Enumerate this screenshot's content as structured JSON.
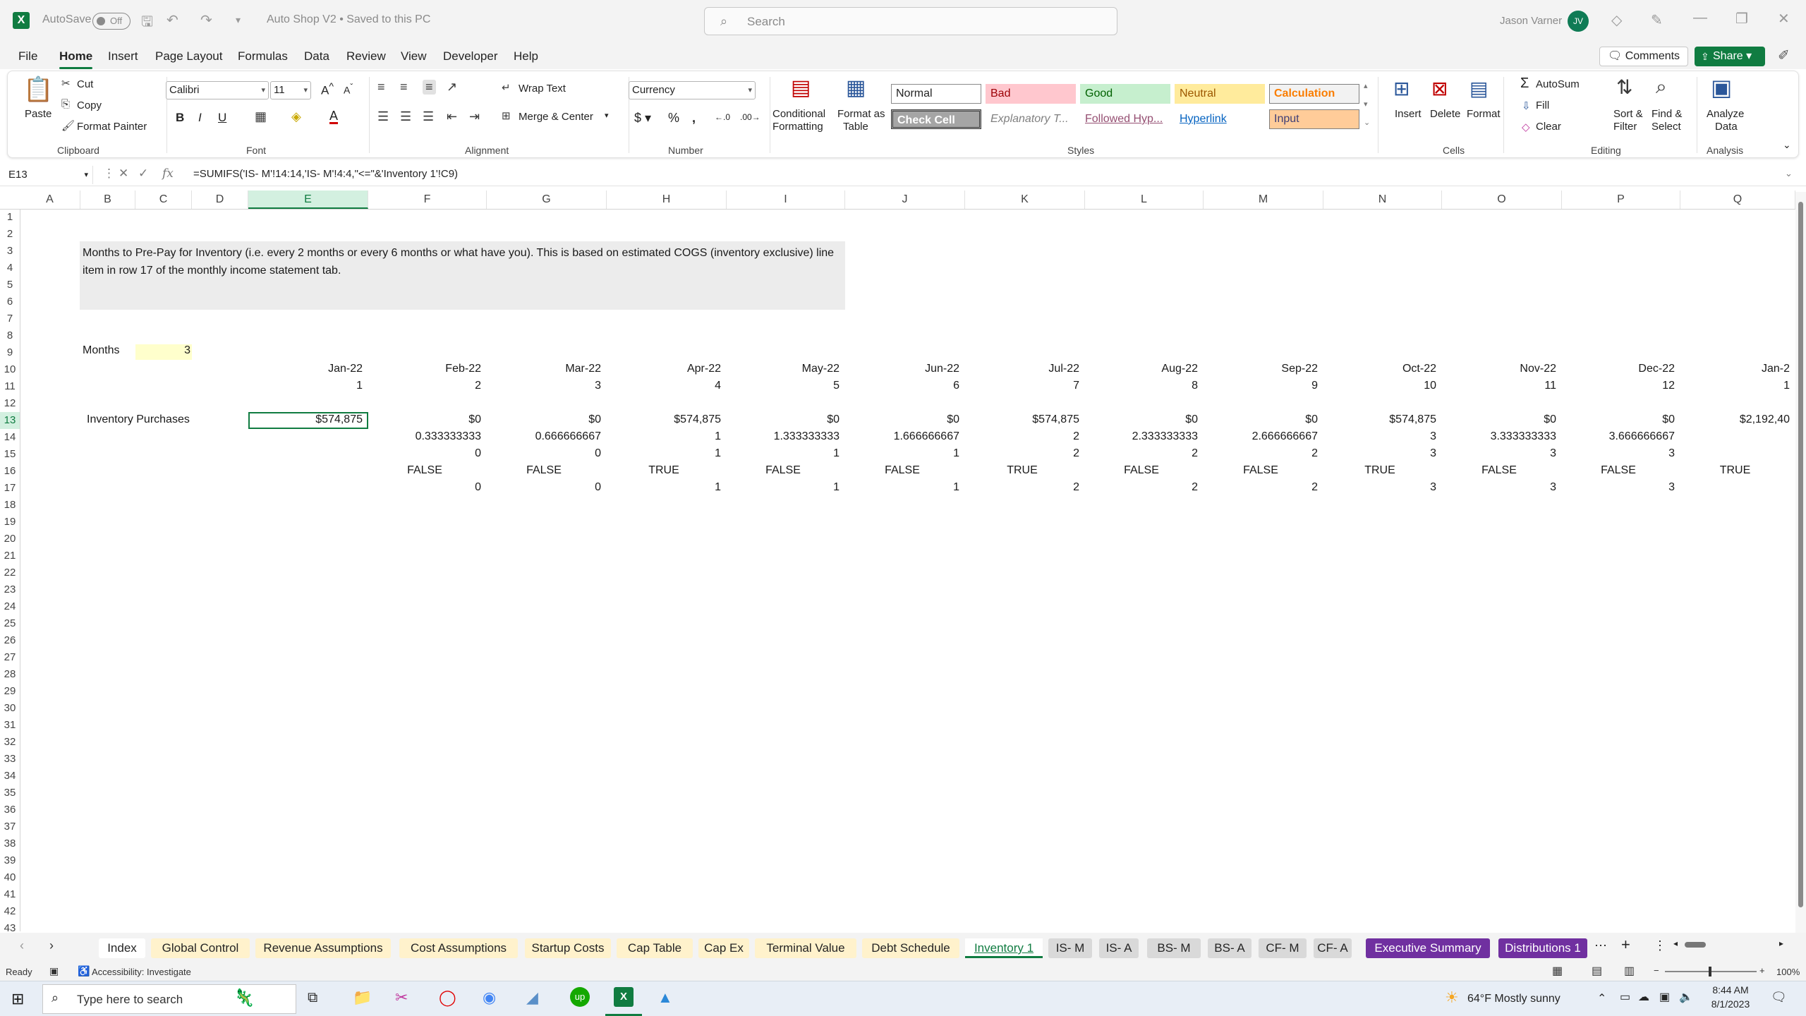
{
  "titlebar": {
    "autosave_label": "AutoSave",
    "autosave_state": "Off",
    "doc_title": "Auto Shop V2 • Saved to this PC",
    "search_placeholder": "Search",
    "user_name": "Jason Varner",
    "user_initials": "JV"
  },
  "menu": {
    "items": [
      "File",
      "Home",
      "Insert",
      "Page Layout",
      "Formulas",
      "Data",
      "Review",
      "View",
      "Developer",
      "Help"
    ],
    "active": "Home",
    "comments_label": "Comments",
    "share_label": "Share"
  },
  "ribbon": {
    "clipboard": {
      "paste": "Paste",
      "cut": "Cut",
      "copy": "Copy",
      "format_painter": "Format Painter",
      "label": "Clipboard"
    },
    "font": {
      "name": "Calibri",
      "size": "11",
      "bold": "B",
      "italic": "I",
      "underline": "U",
      "label": "Font"
    },
    "alignment": {
      "wrap_text": "Wrap Text",
      "merge_center": "Merge & Center",
      "label": "Alignment"
    },
    "number": {
      "format": "Currency",
      "label": "Number"
    },
    "styles": {
      "conditional_formatting": "Conditional",
      "conditional_formatting2": "Formatting",
      "format_as_table": "Format as",
      "format_as_table2": "Table",
      "cells": [
        "Normal",
        "Bad",
        "Good",
        "Neutral",
        "Calculation",
        "Check Cell",
        "Explanatory T...",
        "Followed Hyp...",
        "Hyperlink",
        "Input"
      ],
      "label": "Styles"
    },
    "cells": {
      "insert": "Insert",
      "delete": "Delete",
      "format": "Format",
      "label": "Cells"
    },
    "editing": {
      "autosum": "AutoSum",
      "fill": "Fill",
      "clear": "Clear",
      "sort_filter": "Sort &",
      "sort_filter2": "Filter",
      "find_select": "Find &",
      "find_select2": "Select",
      "label": "Editing"
    },
    "analysis": {
      "analyze_data": "Analyze",
      "analyze_data2": "Data",
      "label": "Analysis"
    }
  },
  "formula_bar": {
    "name_box": "E13",
    "formula": "=SUMIFS('IS- M'!14:14,'IS- M'!4:4,\"<=\"&'Inventory 1'!C9)"
  },
  "grid": {
    "columns": [
      "A",
      "B",
      "C",
      "D",
      "E",
      "F",
      "G",
      "H",
      "I",
      "J",
      "K",
      "L",
      "M",
      "N",
      "O",
      "P",
      "Q"
    ],
    "rows": [
      "1",
      "2",
      "3",
      "4",
      "5",
      "6",
      "7",
      "8",
      "9",
      "10",
      "11",
      "12",
      "13",
      "14",
      "15",
      "16",
      "17",
      "18",
      "19",
      "20",
      "21",
      "22",
      "23",
      "24",
      "25",
      "26",
      "27",
      "28",
      "29",
      "30",
      "31",
      "32",
      "33",
      "34",
      "35",
      "36",
      "37",
      "38",
      "39",
      "40",
      "41",
      "42",
      "43"
    ],
    "note": "Months to Pre-Pay for Inventory (i.e. every 2 months or every 6 months or what have you). This is based on estimated COGS (inventory exclusive) line item in row 17 of the monthly income statement tab.",
    "months_label": "Months",
    "months_value": "3",
    "inventory_label": "Inventory Purchases",
    "row10": [
      "Jan-22",
      "Feb-22",
      "Mar-22",
      "Apr-22",
      "May-22",
      "Jun-22",
      "Jul-22",
      "Aug-22",
      "Sep-22",
      "Oct-22",
      "Nov-22",
      "Dec-22",
      "Jan-2"
    ],
    "row11": [
      "1",
      "2",
      "3",
      "4",
      "5",
      "6",
      "7",
      "8",
      "9",
      "10",
      "11",
      "12",
      "1"
    ],
    "row13": [
      "$574,875",
      "$0",
      "$0",
      "$574,875",
      "$0",
      "$0",
      "$574,875",
      "$0",
      "$0",
      "$574,875",
      "$0",
      "$0",
      "$2,192,40"
    ],
    "row14": [
      "",
      "0.333333333",
      "0.666666667",
      "1",
      "1.333333333",
      "1.666666667",
      "2",
      "2.333333333",
      "2.666666667",
      "3",
      "3.333333333",
      "3.666666667",
      ""
    ],
    "row15": [
      "",
      "0",
      "0",
      "1",
      "1",
      "1",
      "2",
      "2",
      "2",
      "3",
      "3",
      "3",
      ""
    ],
    "row16": [
      "",
      "FALSE",
      "FALSE",
      "TRUE",
      "FALSE",
      "FALSE",
      "TRUE",
      "FALSE",
      "FALSE",
      "TRUE",
      "FALSE",
      "FALSE",
      "TRUE"
    ],
    "row17": [
      "",
      "0",
      "0",
      "1",
      "1",
      "1",
      "2",
      "2",
      "2",
      "3",
      "3",
      "3",
      ""
    ]
  },
  "sheet_tabs": [
    {
      "name": "Index",
      "color": "#ffffff"
    },
    {
      "name": "Global Control",
      "color": "#fff2cc"
    },
    {
      "name": "Revenue Assumptions",
      "color": "#fff2cc"
    },
    {
      "name": "Cost Assumptions",
      "color": "#fff2cc"
    },
    {
      "name": "Startup Costs",
      "color": "#fff2cc"
    },
    {
      "name": "Cap Table",
      "color": "#fff2cc"
    },
    {
      "name": "Cap Ex",
      "color": "#fff2cc"
    },
    {
      "name": "Terminal Value",
      "color": "#fff2cc"
    },
    {
      "name": "Debt Schedule",
      "color": "#fff2cc"
    },
    {
      "name": "Inventory 1",
      "color": "#ffffff"
    },
    {
      "name": "IS- M",
      "color": "#d9d9d9"
    },
    {
      "name": "IS- A",
      "color": "#d9d9d9"
    },
    {
      "name": "BS- M",
      "color": "#d9d9d9"
    },
    {
      "name": "BS- A",
      "color": "#d9d9d9"
    },
    {
      "name": "CF- M",
      "color": "#d9d9d9"
    },
    {
      "name": "CF- A",
      "color": "#d9d9d9"
    },
    {
      "name": "Executive Summary",
      "color": "#7030a0"
    },
    {
      "name": "Distributions 1",
      "color": "#7030a0"
    }
  ],
  "active_tab": "Inventory 1",
  "statusbar": {
    "ready": "Ready",
    "accessibility": "Accessibility: Investigate",
    "zoom": "100%"
  },
  "taskbar": {
    "search_placeholder": "Type here to search",
    "weather": "64°F  Mostly sunny",
    "time": "8:44 AM",
    "date": "8/1/2023"
  },
  "colors": {
    "excel_green": "#107c41",
    "input_yellow": "#ffffcc",
    "note_gray": "#ececec",
    "purple_tab": "#7030a0"
  }
}
